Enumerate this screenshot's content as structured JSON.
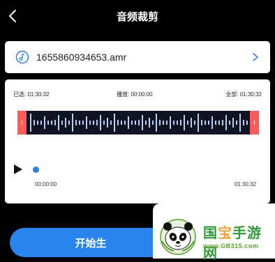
{
  "header": {
    "title": "音频裁剪",
    "back_icon": "chevron-left-icon"
  },
  "file": {
    "icon": "music-note-icon",
    "name": "1655860934653.amr",
    "chevron_icon": "chevron-right-icon"
  },
  "editor": {
    "selected_label": "已选: 01:30:32",
    "playing_label": "播放: 00:00:00",
    "total_label": "全部: 01:30:32",
    "current_time": "00:00:00",
    "end_time": "01:30:32",
    "accent": "#2f7fe6",
    "handle_color": "#ff5a5a"
  },
  "actions": {
    "start_label": "开始生"
  },
  "watermark": {
    "text_1": "国",
    "text_2": "宝",
    "text_3": "手游网",
    "url": "www.GB315.com"
  }
}
